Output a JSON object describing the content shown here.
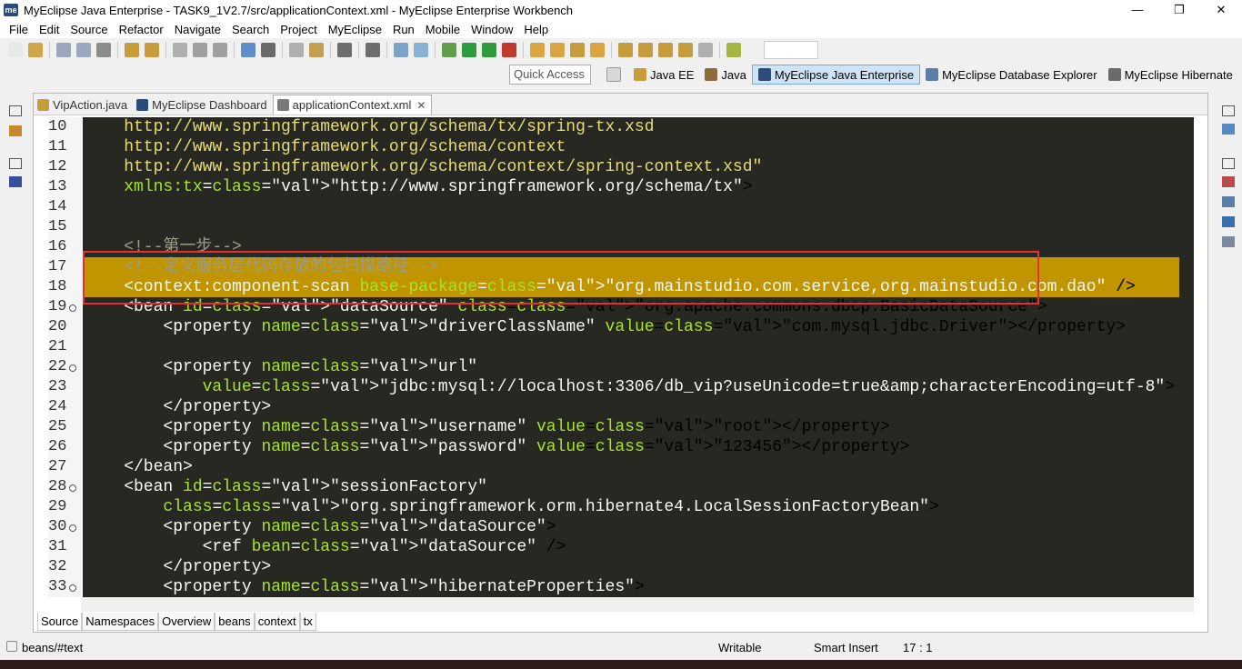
{
  "window": {
    "title": "MyEclipse Java Enterprise - TASK9_1V2.7/src/applicationContext.xml - MyEclipse Enterprise Workbench",
    "logo_text": "me",
    "minimize": "—",
    "restore": "❐",
    "close": "✕"
  },
  "menu": [
    "File",
    "Edit",
    "Source",
    "Refactor",
    "Navigate",
    "Search",
    "Project",
    "MyEclipse",
    "Run",
    "Mobile",
    "Window",
    "Help"
  ],
  "quick_access": {
    "placeholder": "Quick Access"
  },
  "perspectives": [
    {
      "label": "Java EE",
      "icon": "java-ee-icon",
      "active": false
    },
    {
      "label": "Java",
      "icon": "java-icon",
      "active": false
    },
    {
      "label": "MyEclipse Java Enterprise",
      "icon": "myeclipse-icon",
      "active": true
    },
    {
      "label": "MyEclipse Database Explorer",
      "icon": "database-icon",
      "active": false
    },
    {
      "label": "MyEclipse Hibernate",
      "icon": "hibernate-icon",
      "active": false
    }
  ],
  "tabs": [
    {
      "label": "VipAction.java",
      "icon": "java-file-icon",
      "active": false
    },
    {
      "label": "MyEclipse Dashboard",
      "icon": "dashboard-icon",
      "active": false
    },
    {
      "label": "applicationContext.xml",
      "icon": "xml-file-icon",
      "active": true,
      "close": "✕"
    }
  ],
  "code_lines": [
    {
      "n": "10",
      "fold": false,
      "hl": false,
      "text": "    http://www.springframework.org/schema/tx/spring-tx.xsd"
    },
    {
      "n": "11",
      "fold": false,
      "hl": false,
      "text": "    http://www.springframework.org/schema/context"
    },
    {
      "n": "12",
      "fold": false,
      "hl": false,
      "text": "    http://www.springframework.org/schema/context/spring-context.xsd\""
    },
    {
      "n": "13",
      "fold": false,
      "hl": false,
      "text": "    xmlns:tx=\"http://www.springframework.org/schema/tx\">"
    },
    {
      "n": "14",
      "fold": false,
      "hl": false,
      "text": ""
    },
    {
      "n": "15",
      "fold": false,
      "hl": false,
      "text": ""
    },
    {
      "n": "16",
      "fold": false,
      "hl": false,
      "text": "    <!--第一步-->"
    },
    {
      "n": "17",
      "fold": false,
      "hl": true,
      "text": "    <!--定义服务层代码存放的包扫描路径-->"
    },
    {
      "n": "18",
      "fold": false,
      "hl": true,
      "text": "    <context:component-scan base-package=\"org.mainstudio.com.service,org.mainstudio.com.dao\" />"
    },
    {
      "n": "19",
      "fold": true,
      "hl": false,
      "text": "    <bean id=\"dataSource\" class=\"org.apache.commons.dbcp.BasicDataSource\">"
    },
    {
      "n": "20",
      "fold": false,
      "hl": false,
      "text": "        <property name=\"driverClassName\" value=\"com.mysql.jdbc.Driver\"></property>"
    },
    {
      "n": "21",
      "fold": false,
      "hl": false,
      "text": ""
    },
    {
      "n": "22",
      "fold": true,
      "hl": false,
      "text": "        <property name=\"url\""
    },
    {
      "n": "23",
      "fold": false,
      "hl": false,
      "text": "            value=\"jdbc:mysql://localhost:3306/db_vip?useUnicode=true&amp;characterEncoding=utf-8\">"
    },
    {
      "n": "24",
      "fold": false,
      "hl": false,
      "text": "        </property>"
    },
    {
      "n": "25",
      "fold": false,
      "hl": false,
      "text": "        <property name=\"username\" value=\"root\"></property>"
    },
    {
      "n": "26",
      "fold": false,
      "hl": false,
      "text": "        <property name=\"password\" value=\"123456\"></property>"
    },
    {
      "n": "27",
      "fold": false,
      "hl": false,
      "text": "    </bean>"
    },
    {
      "n": "28",
      "fold": true,
      "hl": false,
      "text": "    <bean id=\"sessionFactory\""
    },
    {
      "n": "29",
      "fold": false,
      "hl": false,
      "text": "        class=\"org.springframework.orm.hibernate4.LocalSessionFactoryBean\">"
    },
    {
      "n": "30",
      "fold": true,
      "hl": false,
      "text": "        <property name=\"dataSource\">"
    },
    {
      "n": "31",
      "fold": false,
      "hl": false,
      "text": "            <ref bean=\"dataSource\" />"
    },
    {
      "n": "32",
      "fold": false,
      "hl": false,
      "text": "        </property>"
    },
    {
      "n": "33",
      "fold": true,
      "hl": false,
      "text": "        <property name=\"hibernateProperties\">"
    }
  ],
  "bottom_tabs": [
    {
      "label": "Source",
      "active": true
    },
    {
      "label": "Namespaces",
      "active": false
    },
    {
      "label": "Overview",
      "active": false
    },
    {
      "label": "beans",
      "active": false
    },
    {
      "label": "context",
      "active": false
    },
    {
      "label": "tx",
      "active": false
    }
  ],
  "status": {
    "path": "beans/#text",
    "writable": "Writable",
    "insert_mode": "Smart Insert",
    "position": "17 : 1"
  }
}
